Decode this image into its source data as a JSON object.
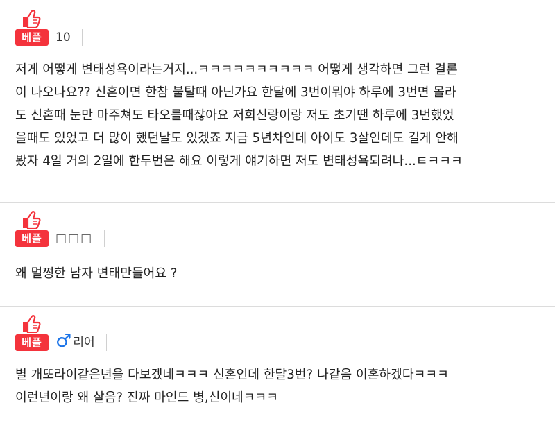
{
  "colors": {
    "best_badge": "#f4333c",
    "male_icon": "#1a73e8"
  },
  "comments": [
    {
      "badge": "베플",
      "badge_icon": "thumbs-up-icon",
      "nickname": "10",
      "text": "저게 어떻게 변태성욕이라는거지...ㅋㅋㅋㅋㅋㅋㅋㅋㅋㅋ 어떻게 생각하면 그런 결론\n이 나오나요?? 신혼이면 한참 불탈때 아닌가요 한달에 3번이뭐야 하루에 3번면 몰라\n도 신혼때 눈만 마주쳐도 타오를때잖아요 저희신랑이랑 저도 초기땐 하루에 3번했었\n을때도 있었고 더 많이 했던날도 있겠죠 지금 5년차인데 아이도 3살인데도 길게 안해\n봤자 4일 거의 2일에 한두번은 해요 이렇게 얘기하면 저도 변태성욕되려나...ㅌㅋㅋㅋ"
    },
    {
      "badge": "베플",
      "badge_icon": "thumbs-up-icon",
      "nickname": "□□□",
      "text": "왜 멀쩡한 남자 변태만들어요 ?"
    },
    {
      "badge": "베플",
      "badge_icon": "thumbs-up-icon",
      "gender_icon": "male-icon",
      "gender_symbol": "♂",
      "nickname": "리어",
      "text": "별 개또라이같은년을 다보겠네ㅋㅋㅋ 신혼인데 한달3번? 나같음 이혼하겠다ㅋㅋㅋ\n이런년이랑 왜 살음? 진짜 마인드 병,신이네ㅋㅋㅋ"
    }
  ]
}
